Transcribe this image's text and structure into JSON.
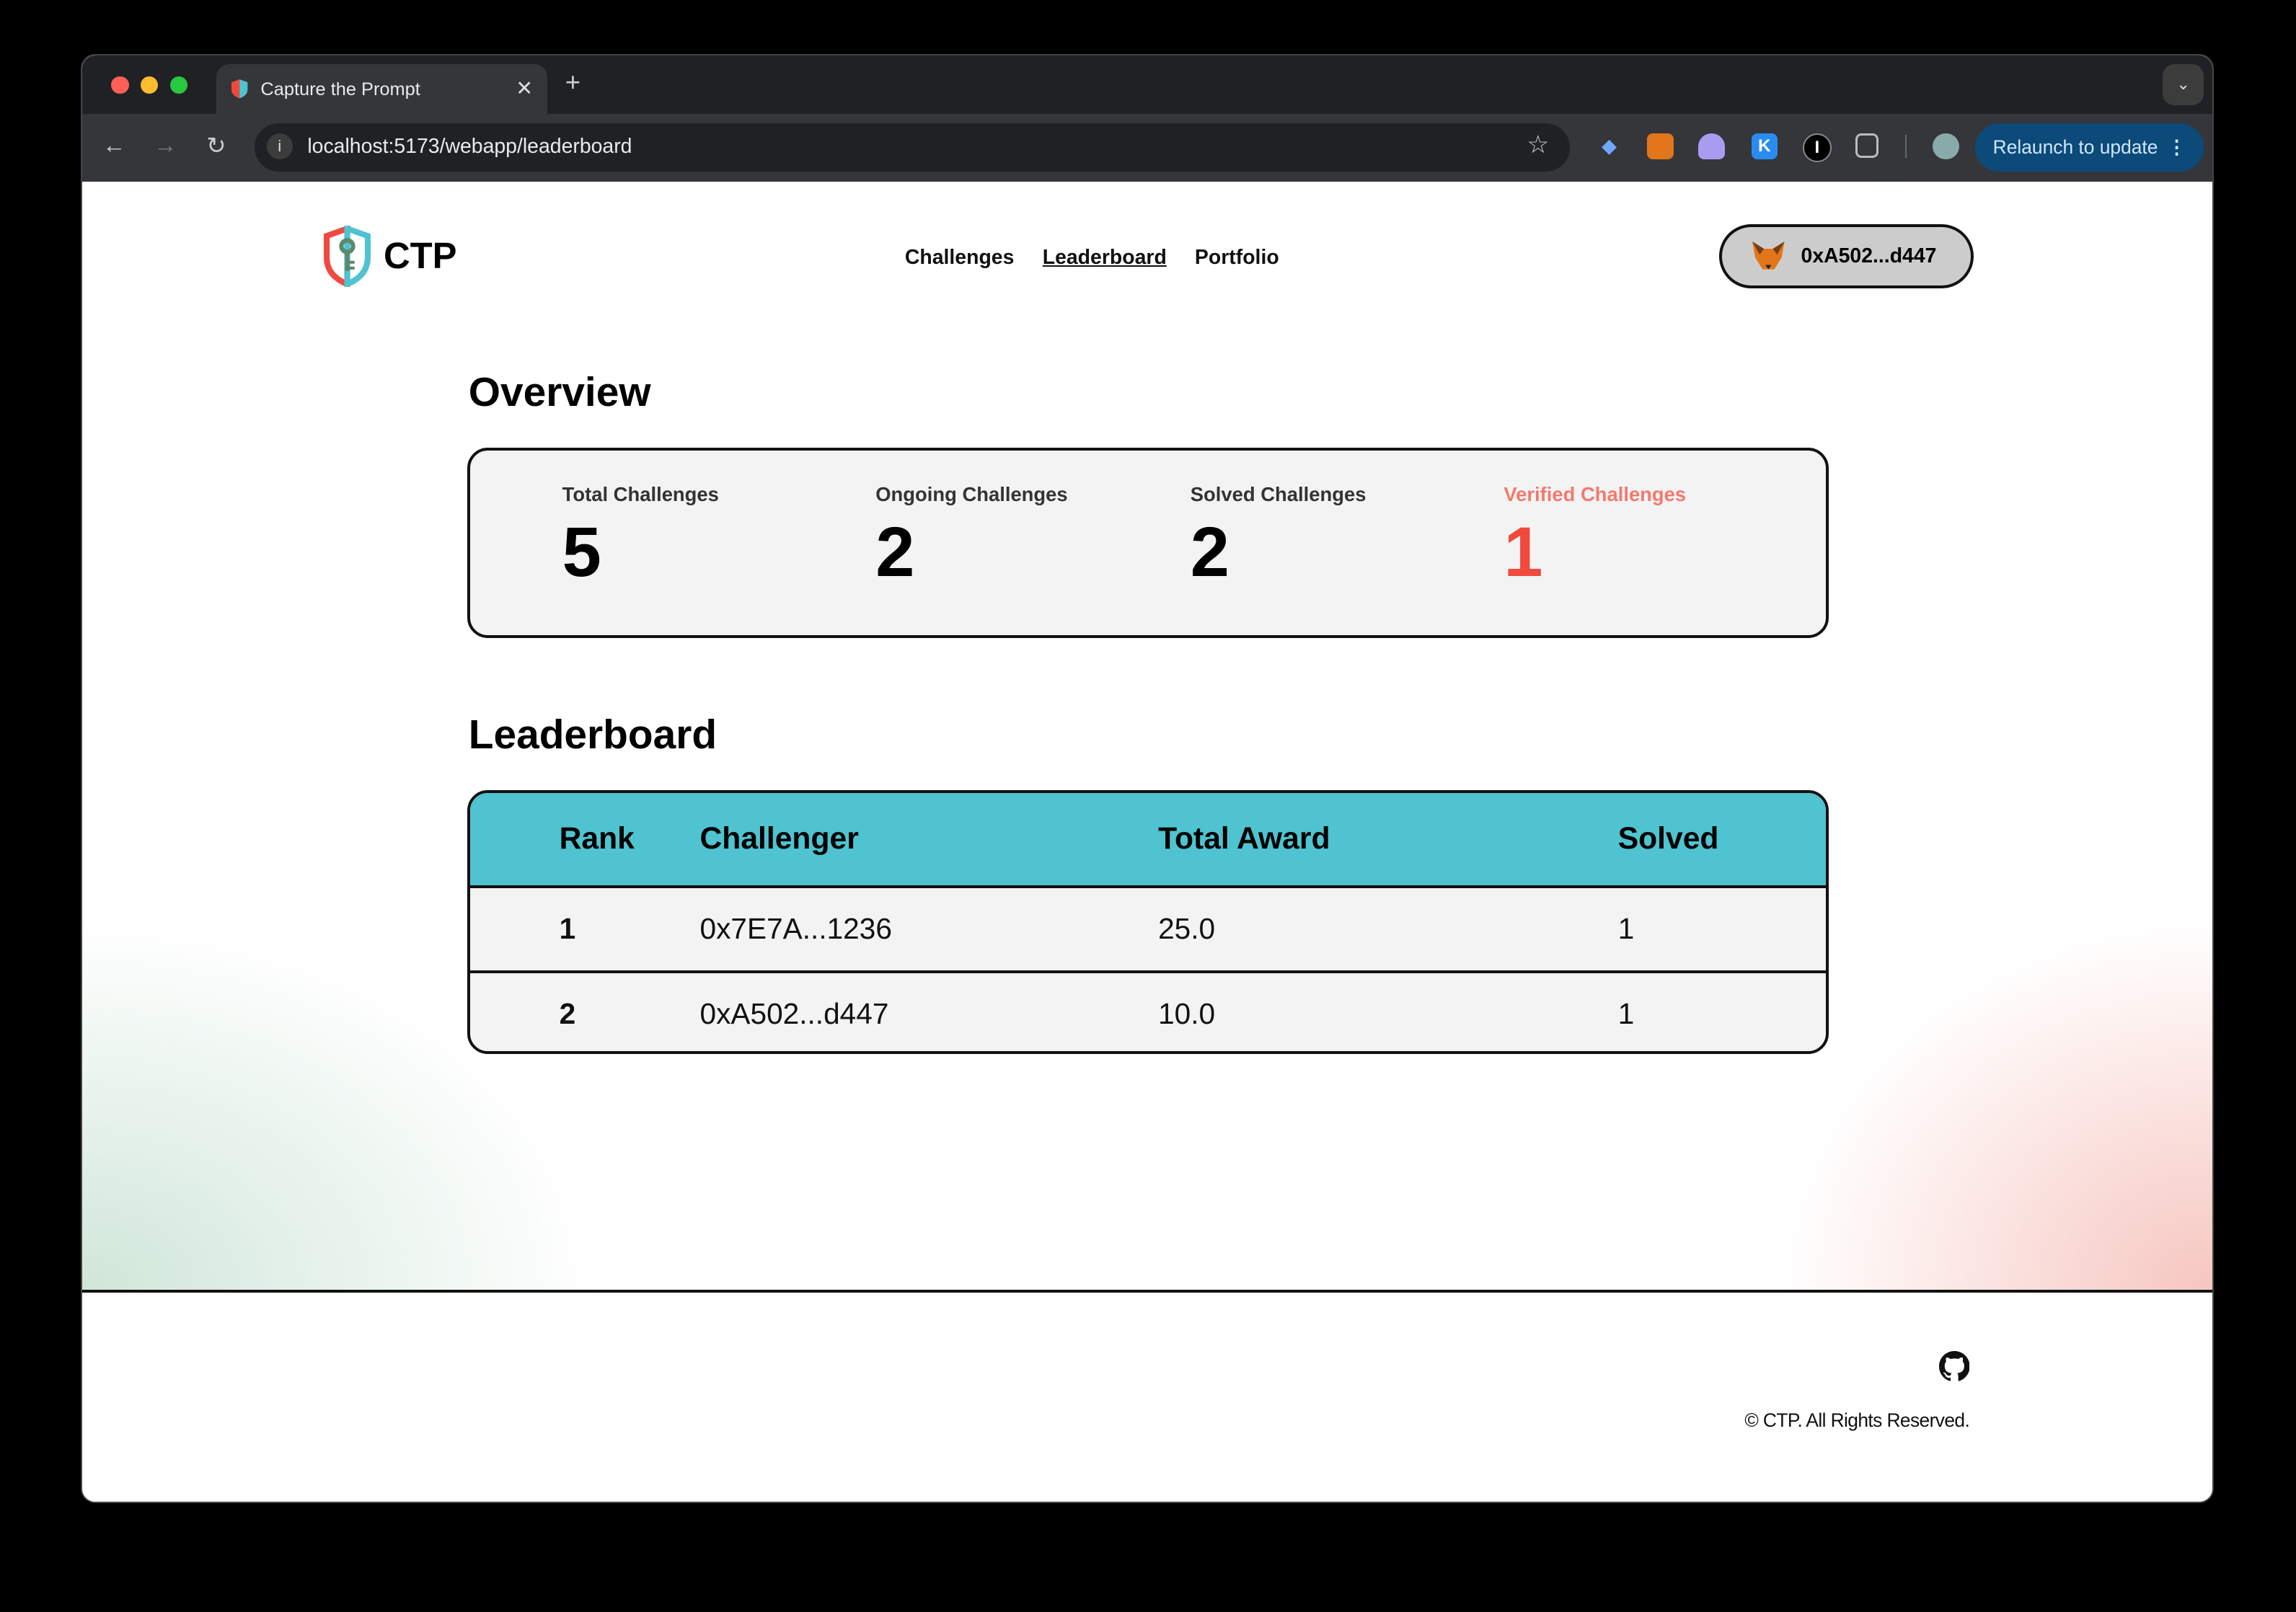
{
  "browser": {
    "tab_title": "Capture the Prompt",
    "url": "localhost:5173/webapp/leaderboard",
    "relaunch_label": "Relaunch to update",
    "extensions": [
      "blue-gem-extension-icon",
      "metamask-extension-icon",
      "ghost-extension-icon",
      "k-extension-icon",
      "wrench-extension-icon",
      "puzzle-extensions-icon"
    ],
    "ext_k": "K",
    "ext_i": "I"
  },
  "header": {
    "brand": "CTP",
    "nav": [
      {
        "label": "Challenges"
      },
      {
        "label": "Leaderboard",
        "active": true
      },
      {
        "label": "Portfolio"
      }
    ],
    "wallet": "0xA502...d447"
  },
  "overview": {
    "title": "Overview",
    "stats": [
      {
        "label": "Total Challenges",
        "value": "5"
      },
      {
        "label": "Ongoing Challenges",
        "value": "2"
      },
      {
        "label": "Solved Challenges",
        "value": "2"
      },
      {
        "label": "Verified Challenges",
        "value": "1",
        "color": "#f04a3e"
      }
    ]
  },
  "leaderboard": {
    "title": "Leaderboard",
    "columns": [
      "Rank",
      "Challenger",
      "Total Award",
      "Solved"
    ],
    "rows": [
      {
        "rank": "1",
        "challenger": "0x7E7A...1236",
        "award": "25.0",
        "solved": "1"
      },
      {
        "rank": "2",
        "challenger": "0xA502...d447",
        "award": "10.0",
        "solved": "1"
      }
    ],
    "header_color": "#4fc3d0"
  },
  "footer": {
    "copyright": "© CTP. All Rights Reserved."
  }
}
